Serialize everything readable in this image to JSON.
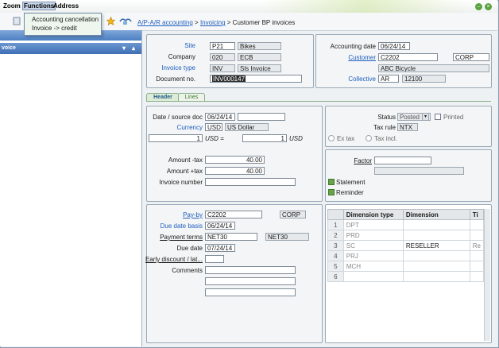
{
  "menu": {
    "zoom": "Zoom",
    "functions": "Functions",
    "address": "Address"
  },
  "functions_menu": {
    "items": [
      "Accounting cancellation",
      "Invoice -> credit"
    ]
  },
  "breadcrumb": {
    "part1": "A/P-A/R accounting",
    "sep1": ">",
    "part2": "Invoicing",
    "sep2": ">",
    "part3": "Customer BP invoices"
  },
  "sidebar": {
    "section_title": "voice"
  },
  "header_panel": {
    "site_label": "Site",
    "site_value": "P21",
    "site_desc": "Bikes",
    "company_label": "Company",
    "company_value": "020",
    "company_desc": "ECB",
    "invoice_type_label": "Invoice type",
    "invoice_type_value": "INV",
    "invoice_type_desc": "Sls Invoice",
    "document_no_label": "Document no.",
    "document_no_value": "INV000147"
  },
  "right_panel": {
    "accounting_date_label": "Accounting date",
    "accounting_date_value": "06/24/14",
    "customer_label": "Customer",
    "customer_value": "C2202",
    "customer_code": "CORP",
    "customer_name": "ABC Bicycle",
    "collective_label": "Collective",
    "collective_value": "AR",
    "collective_desc": "12100"
  },
  "tabs": [
    "Header",
    "Lines"
  ],
  "dates_panel": {
    "date_source_label": "Date / source doc",
    "date_source_value": "06/24/14",
    "currency_label": "Currency",
    "currency_value": "USD",
    "currency_desc": "US Dollar",
    "rate_left": "1",
    "rate_mid_label": "USD =",
    "rate_right": "1",
    "rate_unit": "USD",
    "amount_notax_label": "Amount -tax",
    "amount_notax_value": "40.00",
    "amount_tax_label": "Amount +tax",
    "amount_tax_value": "40.00",
    "invoice_number_label": "Invoice number"
  },
  "status_panel": {
    "status_label": "Status",
    "status_value": "Posted",
    "printed_label": "Printed",
    "tax_rule_label": "Tax rule",
    "tax_rule_value": "NTX",
    "ex_tax_label": "Ex tax",
    "tax_incl_label": "Tax incl."
  },
  "factor_panel": {
    "factor_label": "Factor",
    "statement_label": "Statement",
    "reminder_label": "Reminder"
  },
  "payment_panel": {
    "pay_by_label": "Pay-by",
    "pay_by_value": "C2202",
    "pay_by_code": "CORP",
    "due_date_basis_label": "Due date basis",
    "due_date_basis_value": "06/24/14",
    "payment_terms_label": "Payment terms",
    "payment_terms_value": "NET30",
    "payment_terms_desc": "NET30",
    "due_date_label": "Due date",
    "due_date_value": "07/24/14",
    "early_discount_label": "Early discount / lat...",
    "comments_label": "Comments"
  },
  "dimension_grid": {
    "columns": [
      "Dimension type",
      "Dimension",
      "Ti"
    ],
    "rows": [
      {
        "n": "1",
        "type": "DPT",
        "dim": "",
        "ti": ""
      },
      {
        "n": "2",
        "type": "PRD",
        "dim": "",
        "ti": ""
      },
      {
        "n": "3",
        "type": "SC",
        "dim": "RESELLER",
        "ti": "Re"
      },
      {
        "n": "4",
        "type": "PRJ",
        "dim": "",
        "ti": ""
      },
      {
        "n": "5",
        "type": "MCH",
        "dim": "",
        "ti": ""
      },
      {
        "n": "6",
        "type": "",
        "dim": "",
        "ti": ""
      }
    ]
  },
  "colors": {
    "link": "#1f5fbf",
    "sidebar_header": "#4d7fc2",
    "tab_green": "#dcecd6",
    "check_green": "#6aa24a"
  }
}
